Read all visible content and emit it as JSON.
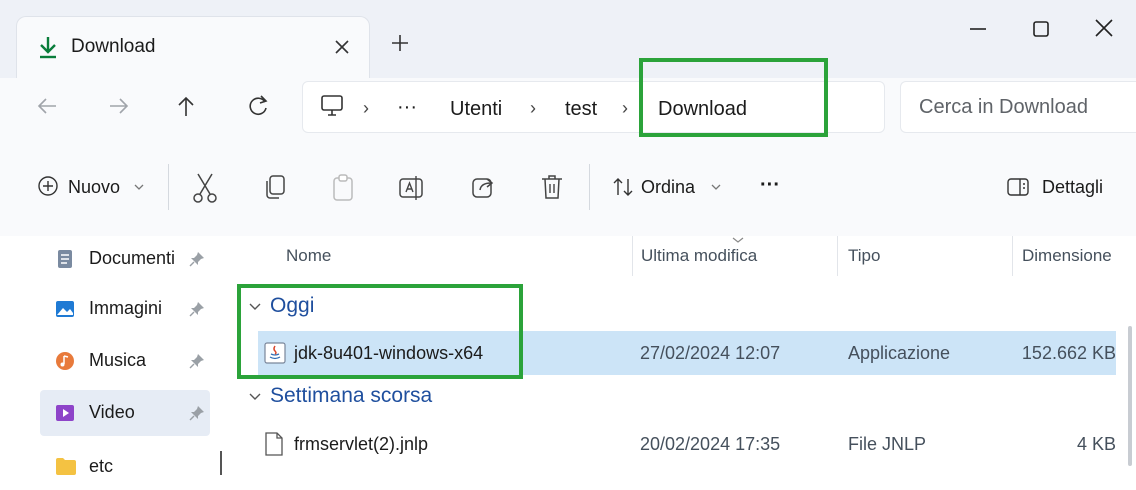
{
  "window": {
    "tab_title": "Download",
    "new_tab": "+"
  },
  "nav": {
    "breadcrumb": [
      "Utenti",
      "test",
      "Download"
    ],
    "ellipsis": "···",
    "search_placeholder": "Cerca in Download"
  },
  "toolbar": {
    "new_label": "Nuovo",
    "sort_label": "Ordina",
    "more_label": "···",
    "details_label": "Dettagli"
  },
  "sidebar": {
    "items": [
      {
        "label": "Documenti",
        "icon": "documents-icon",
        "pinned": true
      },
      {
        "label": "Immagini",
        "icon": "pictures-icon",
        "pinned": true
      },
      {
        "label": "Musica",
        "icon": "music-icon",
        "pinned": true
      },
      {
        "label": "Video",
        "icon": "video-icon",
        "pinned": true,
        "selected": true
      },
      {
        "label": "etc",
        "icon": "folder-icon",
        "pinned": false
      }
    ]
  },
  "files": {
    "columns": {
      "name": "Nome",
      "modified": "Ultima modifica",
      "type": "Tipo",
      "size": "Dimensione"
    },
    "groups": [
      {
        "name": "Oggi",
        "rows": [
          {
            "name": "jdk-8u401-windows-x64",
            "modified": "27/02/2024 12:07",
            "type": "Applicazione",
            "size": "152.662 KB",
            "selected": true,
            "icon": "java-installer-icon"
          }
        ]
      },
      {
        "name": "Settimana scorsa",
        "rows": [
          {
            "name": "frmservlet(2).jnlp",
            "modified": "20/02/2024 17:35",
            "type": "File JNLP",
            "size": "4 KB",
            "selected": false,
            "icon": "file-icon"
          }
        ]
      }
    ]
  },
  "colors": {
    "accent": "#0067c0",
    "selection": "#cce4f7",
    "highlight_box": "#2ba33a",
    "group_header": "#1f4f9e"
  }
}
